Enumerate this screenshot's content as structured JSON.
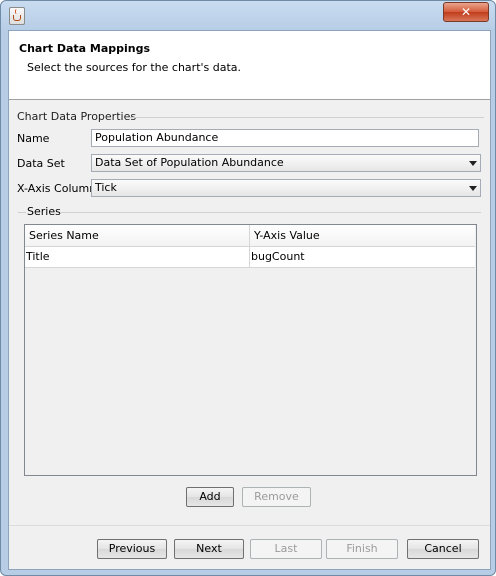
{
  "window": {
    "close_label": "✕"
  },
  "banner": {
    "title": "Chart Data Mappings",
    "description": "Select the sources for the chart's data."
  },
  "properties": {
    "group_title": "Chart Data Properties",
    "name_label": "Name",
    "name_value": "Population Abundance",
    "dataset_label": "Data Set",
    "dataset_value": "Data Set of Population Abundance",
    "xaxis_label": "X-Axis Column",
    "xaxis_value": "Tick"
  },
  "series": {
    "group_title": "Series",
    "columns": [
      "Series Name",
      "Y-Axis Value"
    ],
    "rows": [
      {
        "series_name": "Title",
        "y_axis_value": "bugCount"
      }
    ],
    "add_label": "Add",
    "remove_label": "Remove"
  },
  "wizard": {
    "previous": "Previous",
    "next": "Next",
    "last": "Last",
    "finish": "Finish",
    "cancel": "Cancel"
  }
}
